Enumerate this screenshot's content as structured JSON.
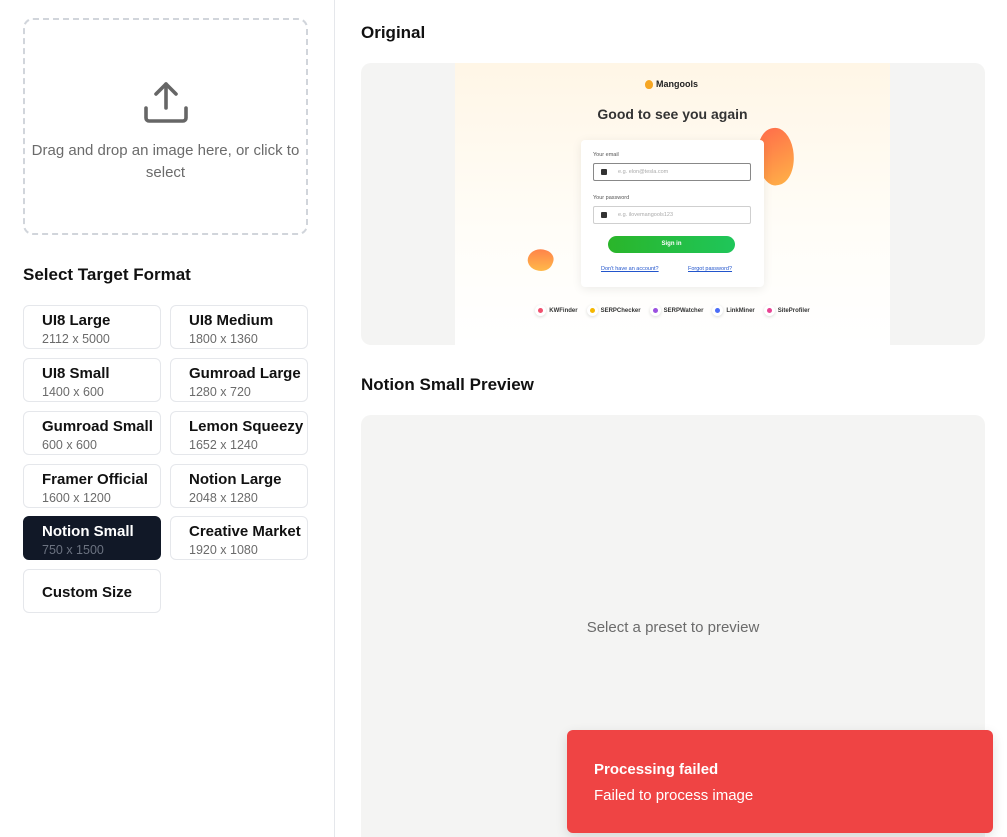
{
  "upload": {
    "icon": "upload-icon",
    "text": "Drag and drop an image here, or click to select"
  },
  "formats": {
    "title": "Select Target Format",
    "presets": [
      {
        "name": "UI8 Large",
        "size": "2112 x 5000"
      },
      {
        "name": "UI8 Medium",
        "size": "1800 x 1360"
      },
      {
        "name": "UI8 Small",
        "size": "1400 x 600"
      },
      {
        "name": "Gumroad Large",
        "size": "1280 x 720"
      },
      {
        "name": "Gumroad Small",
        "size": "600 x 600"
      },
      {
        "name": "Lemon Squeezy",
        "size": "1652 x 1240"
      },
      {
        "name": "Framer Official",
        "size": "1600 x 1200"
      },
      {
        "name": "Notion Large",
        "size": "2048 x 1280"
      },
      {
        "name": "Notion Small",
        "size": "750 x 1500"
      },
      {
        "name": "Creative Market",
        "size": "1920 x 1080"
      }
    ],
    "selected": "Notion Small",
    "custom_label": "Custom Size"
  },
  "original": {
    "title": "Original",
    "thumbnail": {
      "brand": "Mangools",
      "heading": "Good to see you again",
      "email_label": "Your email",
      "email_placeholder": "e.g. elon@tesla.com",
      "password_label": "Your password",
      "password_placeholder": "e.g. ilovemangools123",
      "signin_label": "Sign in",
      "no_account_link": "Don't have an account?",
      "forgot_link": "Forgot password?",
      "tools": [
        {
          "name": "KWFinder",
          "color": "#f0506e"
        },
        {
          "name": "SERPChecker",
          "color": "#f5b700"
        },
        {
          "name": "SERPWatcher",
          "color": "#9b51e0"
        },
        {
          "name": "LinkMiner",
          "color": "#4a6cf7"
        },
        {
          "name": "SiteProfiler",
          "color": "#e84393"
        }
      ]
    }
  },
  "preview": {
    "title": "Notion Small Preview",
    "empty_text": "Select a preset to preview"
  },
  "toast": {
    "title": "Processing failed",
    "message": "Failed to process image",
    "color": "#ef4444"
  }
}
